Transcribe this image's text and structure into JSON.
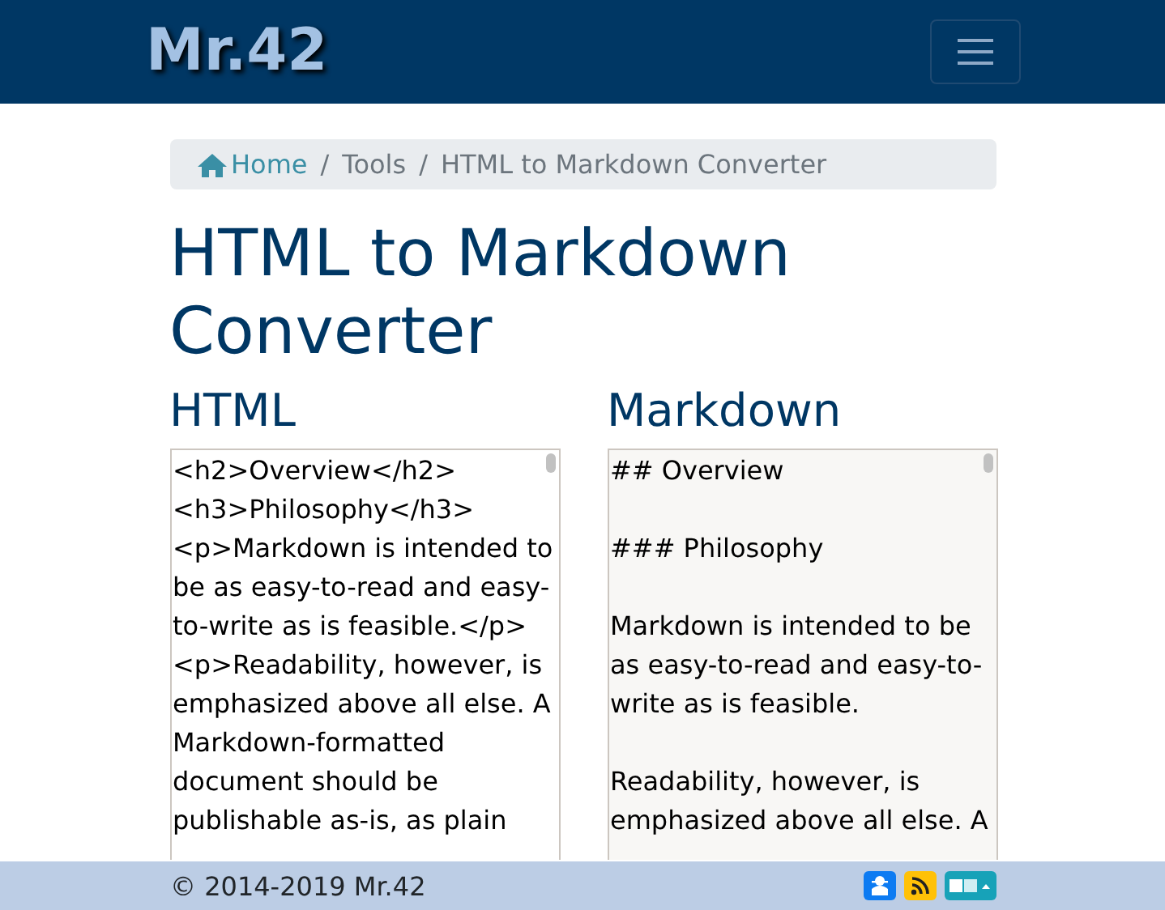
{
  "navbar": {
    "brand": "Mr.42"
  },
  "breadcrumb": [
    {
      "label": "Home",
      "kind": "link"
    },
    {
      "separator": "/",
      "label": "Tools",
      "kind": "text"
    },
    {
      "separator": "/",
      "label": "HTML to Markdown Converter",
      "kind": "current"
    }
  ],
  "title": "HTML to Markdown Converter",
  "panels": [
    {
      "heading": "HTML",
      "kind": "input",
      "value": "<h2>Overview</h2>\n<h3>Philosophy</h3>\n<p>Markdown is intended to be as easy-to-read and easy-to-write as is feasible.</p>\n<p>Readability, however, is emphasized above all else. A Markdown-formatted document should be publishable as-is, as plain"
    },
    {
      "heading": "Markdown",
      "kind": "output",
      "value": "## Overview\n\n### Philosophy\n\nMarkdown is intended to be as easy-to-read and easy-to-write as is feasible.\n\nReadability, however, is emphasized above all else. A"
    }
  ],
  "footer": {
    "copyright": "© 2014-2019 Mr.42",
    "buttons": [
      {
        "kind": "privacy",
        "color": "#0d7bf2"
      },
      {
        "kind": "rss",
        "color": "#ffc107"
      },
      {
        "kind": "language",
        "color": "#17a2b8"
      }
    ]
  }
}
